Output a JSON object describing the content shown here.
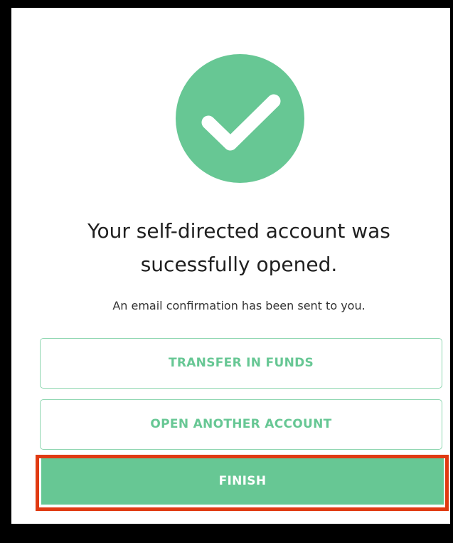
{
  "colors": {
    "accent": "#67c794",
    "highlight": "#e03a12"
  },
  "success": {
    "icon": "checkmark-icon",
    "headline_line1": "Your self-directed account was",
    "headline_line2": "sucessfully opened.",
    "subtext": "An email confirmation has been sent to you."
  },
  "actions": {
    "transfer_label": "TRANSFER IN FUNDS",
    "open_another_label": "OPEN ANOTHER ACCOUNT",
    "finish_label": "FINISH"
  }
}
